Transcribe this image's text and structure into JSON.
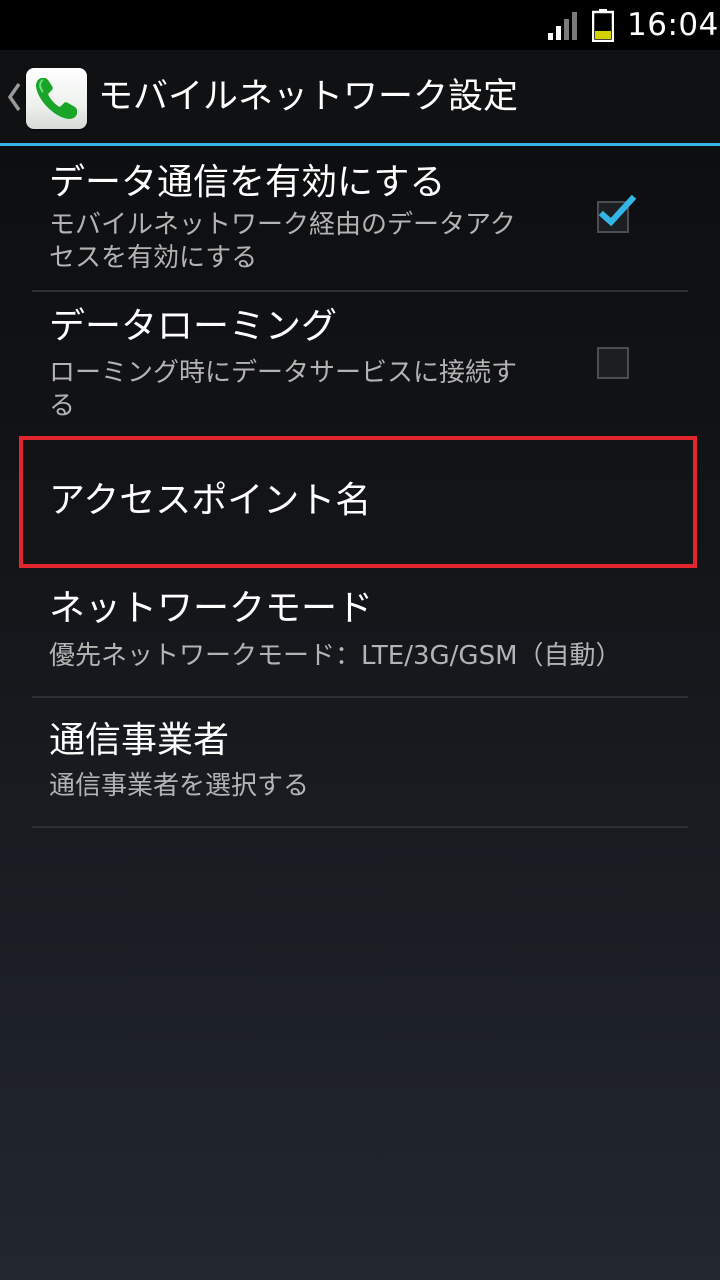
{
  "status_bar": {
    "time": "16:04",
    "signal_icon": "signal-icon",
    "battery_icon": "battery-icon",
    "battery_color": "#d4d100"
  },
  "action_bar": {
    "title": "モバイルネットワーク設定",
    "app_icon": "phone-icon",
    "accent_color": "#33b5e5"
  },
  "preferences": [
    {
      "title": "データ通信を有効にする",
      "summary_line1": "モバイルネットワーク経由のデータアク",
      "summary_line2": "セスを有効にする",
      "checked": true
    },
    {
      "title": "データローミング",
      "summary_line1": "ローミング時にデータサービスに接続す",
      "summary_line2": "る",
      "checked": false
    },
    {
      "title": "アクセスポイント名"
    },
    {
      "title": "ネットワークモード",
      "summary": "優先ネットワークモード：LTE/3G/GSM（自動）"
    },
    {
      "title": "通信事業者",
      "summary": "通信事業者を選択する"
    }
  ],
  "highlight_color": "#e3262e"
}
